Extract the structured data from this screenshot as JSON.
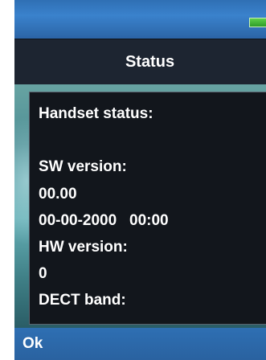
{
  "header": {
    "title": "Status"
  },
  "status_bar": {
    "battery_icon": "battery-icon"
  },
  "content": {
    "heading": "Handset status:",
    "sw_version_label": "SW version:",
    "sw_version_value": "00.00",
    "sw_date_time": "00-00-2000   00:00",
    "hw_version_label": "HW version:",
    "hw_version_value": "0",
    "dect_band_label": "DECT band:"
  },
  "softkeys": {
    "left_label": "Ok"
  },
  "colors": {
    "status_bar_blue": "#3a82cc",
    "title_bar": "#1d2531",
    "panel_bg": "#12161c",
    "softkey_bar": "#2e6fb3",
    "battery_green": "#5fd04a",
    "text": "#ffffff"
  }
}
